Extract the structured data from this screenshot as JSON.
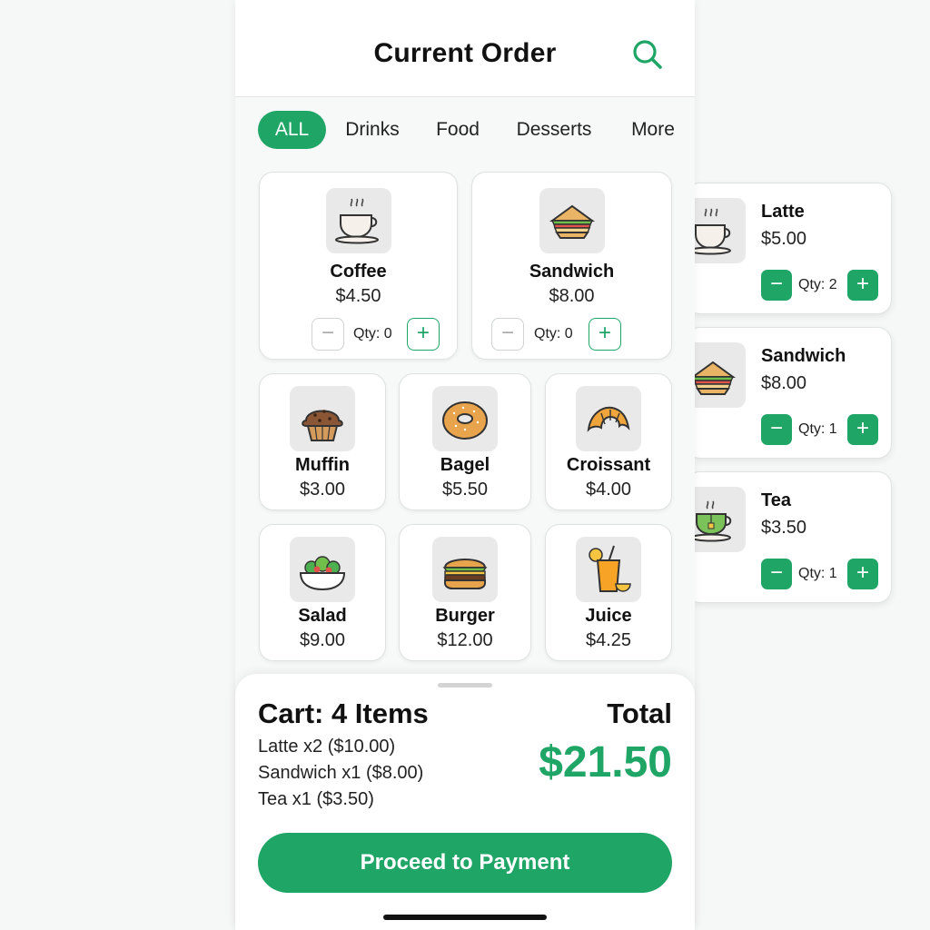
{
  "header": {
    "title": "Current Order"
  },
  "icons": {
    "search": "search-icon"
  },
  "colors": {
    "accent": "#1fa566",
    "thumb_bg": "#e9e9e9"
  },
  "tabs": [
    {
      "label": "ALL",
      "active": true
    },
    {
      "label": "Drinks",
      "active": false
    },
    {
      "label": "Food",
      "active": false
    },
    {
      "label": "Desserts",
      "active": false
    },
    {
      "label": "More",
      "active": false
    }
  ],
  "featured": [
    {
      "name": "Coffee",
      "price": "$4.50",
      "qty_label": "Qty: 0",
      "icon": "coffee-cup-icon"
    },
    {
      "name": "Sandwich",
      "price": "$8.00",
      "qty_label": "Qty: 0",
      "icon": "sandwich-icon"
    }
  ],
  "products": [
    {
      "name": "Muffin",
      "price": "$3.00",
      "icon": "muffin-icon"
    },
    {
      "name": "Bagel",
      "price": "$5.50",
      "icon": "bagel-icon"
    },
    {
      "name": "Croissant",
      "price": "$4.00",
      "icon": "croissant-icon"
    },
    {
      "name": "Salad",
      "price": "$9.00",
      "icon": "salad-icon"
    },
    {
      "name": "Burger",
      "price": "$12.00",
      "icon": "burger-icon"
    },
    {
      "name": "Juice",
      "price": "$4.25",
      "icon": "juice-icon"
    }
  ],
  "order_items": [
    {
      "name": "Latte",
      "price": "$5.00",
      "qty_label": "Qty: 2",
      "icon": "latte-icon"
    },
    {
      "name": "Sandwich",
      "price": "$8.00",
      "qty_label": "Qty: 1",
      "icon": "sandwich-icon"
    },
    {
      "name": "Tea",
      "price": "$3.50",
      "qty_label": "Qty: 1",
      "icon": "tea-icon"
    }
  ],
  "cart": {
    "title": "Cart: 4 Items",
    "total_label": "Total",
    "total_value": "$21.50",
    "lines": [
      "Latte x2 ($10.00)",
      "Sandwich x1 ($8.00)",
      "Tea x1 ($3.50)"
    ],
    "pay_label": "Proceed to Payment"
  },
  "controls": {
    "minus": "−",
    "plus": "+"
  }
}
